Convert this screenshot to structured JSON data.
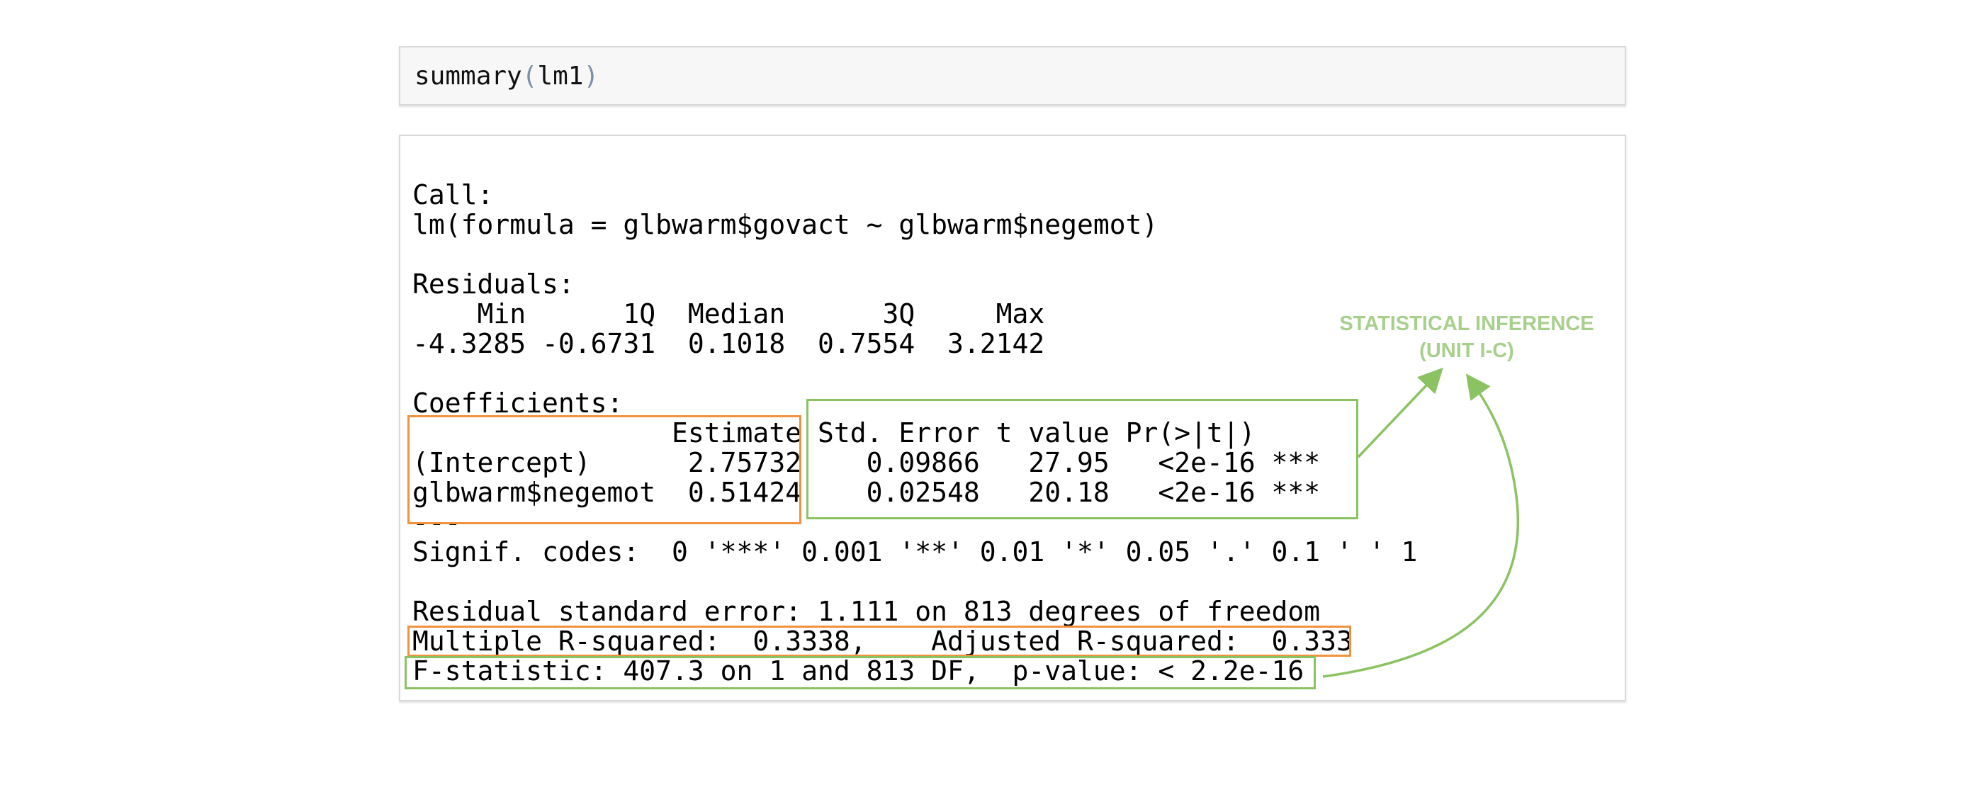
{
  "input_cell": {
    "fn": "summary",
    "open": "(",
    "arg": "lm1",
    "close": ")"
  },
  "output": {
    "lines": [
      "Call:",
      "lm(formula = glbwarm$govact ~ glbwarm$negemot)",
      "",
      "Residuals:",
      "    Min      1Q  Median      3Q     Max ",
      "-4.3285 -0.6731  0.1018  0.7554  3.2142 ",
      "",
      "Coefficients:",
      "                Estimate Std. Error t value Pr(>|t|)    ",
      "(Intercept)      2.75732    0.09866   27.95   <2e-16 ***",
      "glbwarm$negemot  0.51424    0.02548   20.18   <2e-16 ***",
      "---",
      "Signif. codes:  0 '***' 0.001 '**' 0.01 '*' 0.05 '.' 0.1 ' ' 1",
      "",
      "Residual standard error: 1.111 on 813 degrees of freedom",
      "Multiple R-squared:  0.3338,\tAdjusted R-squared:  0.333 ",
      "F-statistic: 407.3 on 1 and 813 DF,  p-value: < 2.2e-16"
    ]
  },
  "annotation": {
    "line1": "STATISTICAL INFERENCE",
    "line2": "(UNIT I-C)"
  },
  "colors": {
    "orange_highlight": "#f0923e",
    "green_highlight": "#8bc363",
    "annotation_text": "#a8d08d"
  }
}
